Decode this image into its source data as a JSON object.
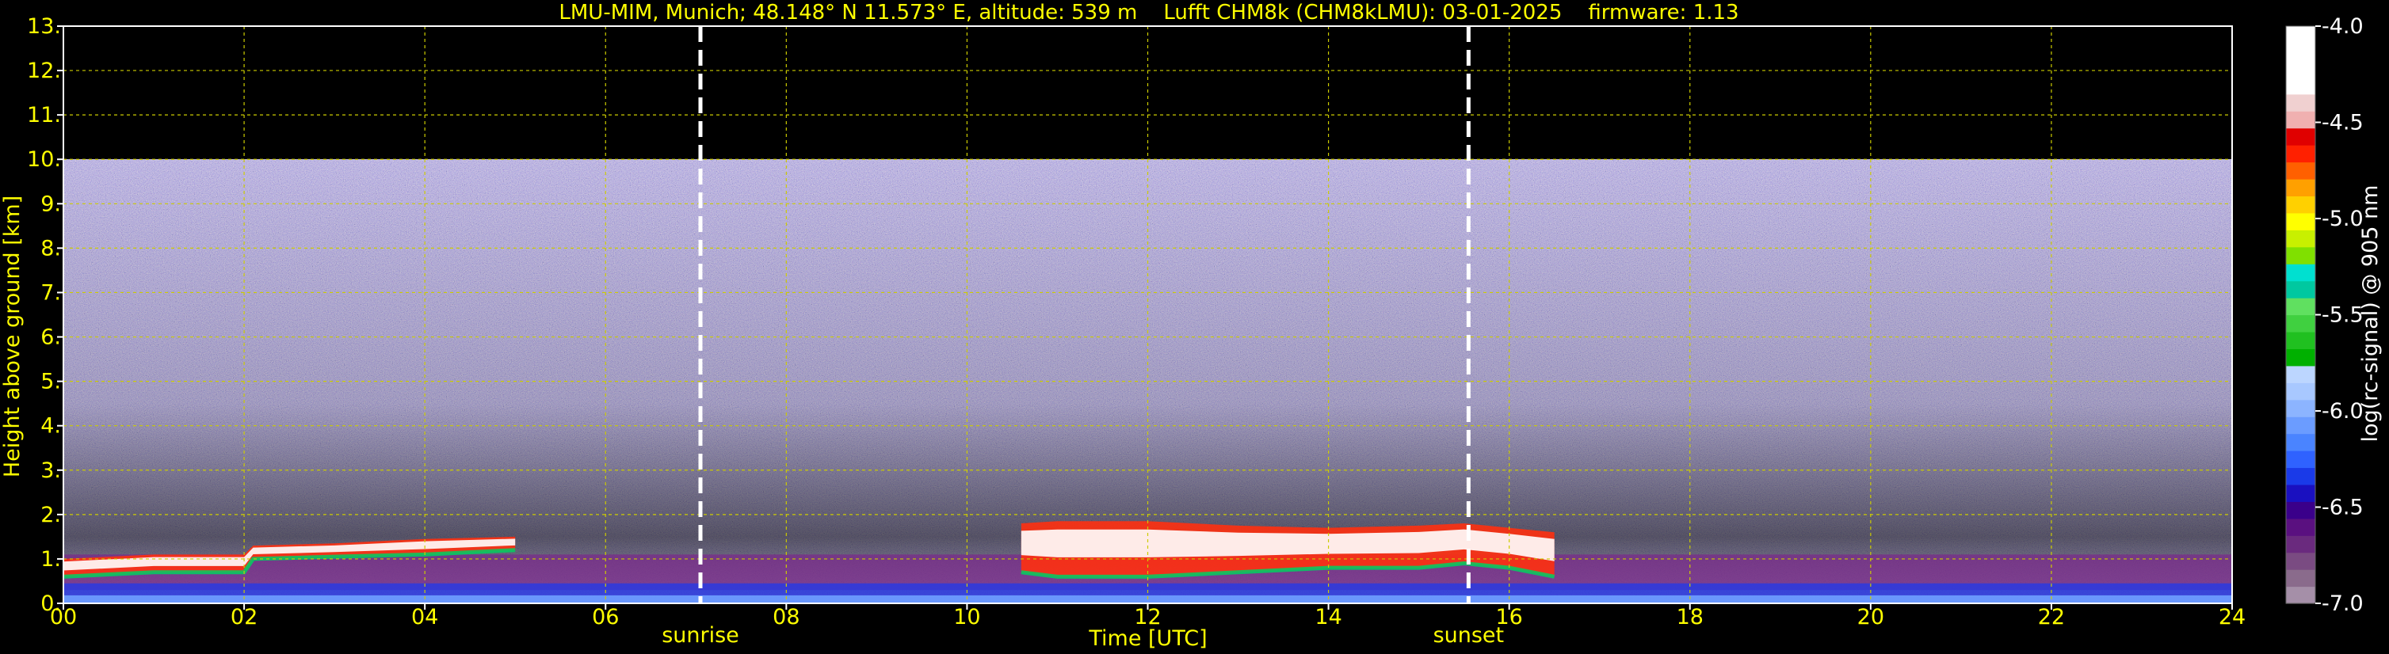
{
  "chart_data": {
    "type": "heatmap",
    "title": "LMU-MIM, Munich; 48.148° N 11.573° E, altitude: 539 m    Lufft CHM8k (CHM8kLMU): 03-01-2025    firmware: 1.13",
    "xlabel": "Time [UTC]",
    "ylabel": "Height above ground [km]",
    "xlim": [
      0,
      24
    ],
    "ylim": [
      0,
      13
    ],
    "x_ticks": [
      "00",
      "02",
      "04",
      "06",
      "08",
      "10",
      "12",
      "14",
      "16",
      "18",
      "20",
      "22",
      "24"
    ],
    "y_ticks": [
      "0.",
      "1.",
      "2.",
      "3.",
      "4.",
      "5.",
      "6.",
      "7.",
      "8.",
      "9.",
      "10.",
      "11.",
      "12.",
      "13."
    ],
    "grid": true,
    "colorbar": {
      "label": "log(rc-signal) @ 905 nm",
      "range": [
        -7.0,
        -4.0
      ],
      "ticks": [
        "-4.0",
        "-4.5",
        "-5.0",
        "-5.5",
        "-6.0",
        "-6.5",
        "-7.0"
      ],
      "colors": [
        "#a58fa8",
        "#8a6b8c",
        "#7a4b82",
        "#6a2a7e",
        "#5a1080",
        "#3a008a",
        "#1a10c0",
        "#1a3ae8",
        "#2f62ff",
        "#4a84ff",
        "#6b9cff",
        "#8cb4ff",
        "#a8c8ff",
        "#bcd6ff",
        "#00b000",
        "#20c020",
        "#40d040",
        "#60e060",
        "#00c8a0",
        "#00e0d0",
        "#80e000",
        "#c8f000",
        "#ffff00",
        "#ffd000",
        "#ffa000",
        "#ff6000",
        "#ff2000",
        "#e00000",
        "#f0b0b0",
        "#f0d0d0",
        "#ffffff",
        "#ffffff",
        "#ffffff",
        "#ffffff"
      ]
    },
    "markers": [
      {
        "x": 7.05,
        "label": "sunrise"
      },
      {
        "x": 15.55,
        "label": "sunset"
      }
    ],
    "signal_top_km": 10,
    "cloud_layers": [
      {
        "x": [
          0,
          1,
          2,
          2.1,
          3,
          4,
          5
        ],
        "top": [
          1.0,
          1.1,
          1.1,
          1.3,
          1.35,
          1.45,
          1.5
        ],
        "base": [
          0.6,
          0.7,
          0.7,
          1.0,
          1.05,
          1.1,
          1.2
        ]
      },
      {
        "x": [
          10.6,
          11,
          12,
          13,
          14,
          15,
          15.5,
          16,
          16.5
        ],
        "top": [
          1.8,
          1.85,
          1.85,
          1.75,
          1.7,
          1.75,
          1.8,
          1.7,
          1.6
        ],
        "base": [
          0.7,
          0.6,
          0.6,
          0.7,
          0.8,
          0.8,
          0.9,
          0.8,
          0.6
        ]
      }
    ]
  }
}
